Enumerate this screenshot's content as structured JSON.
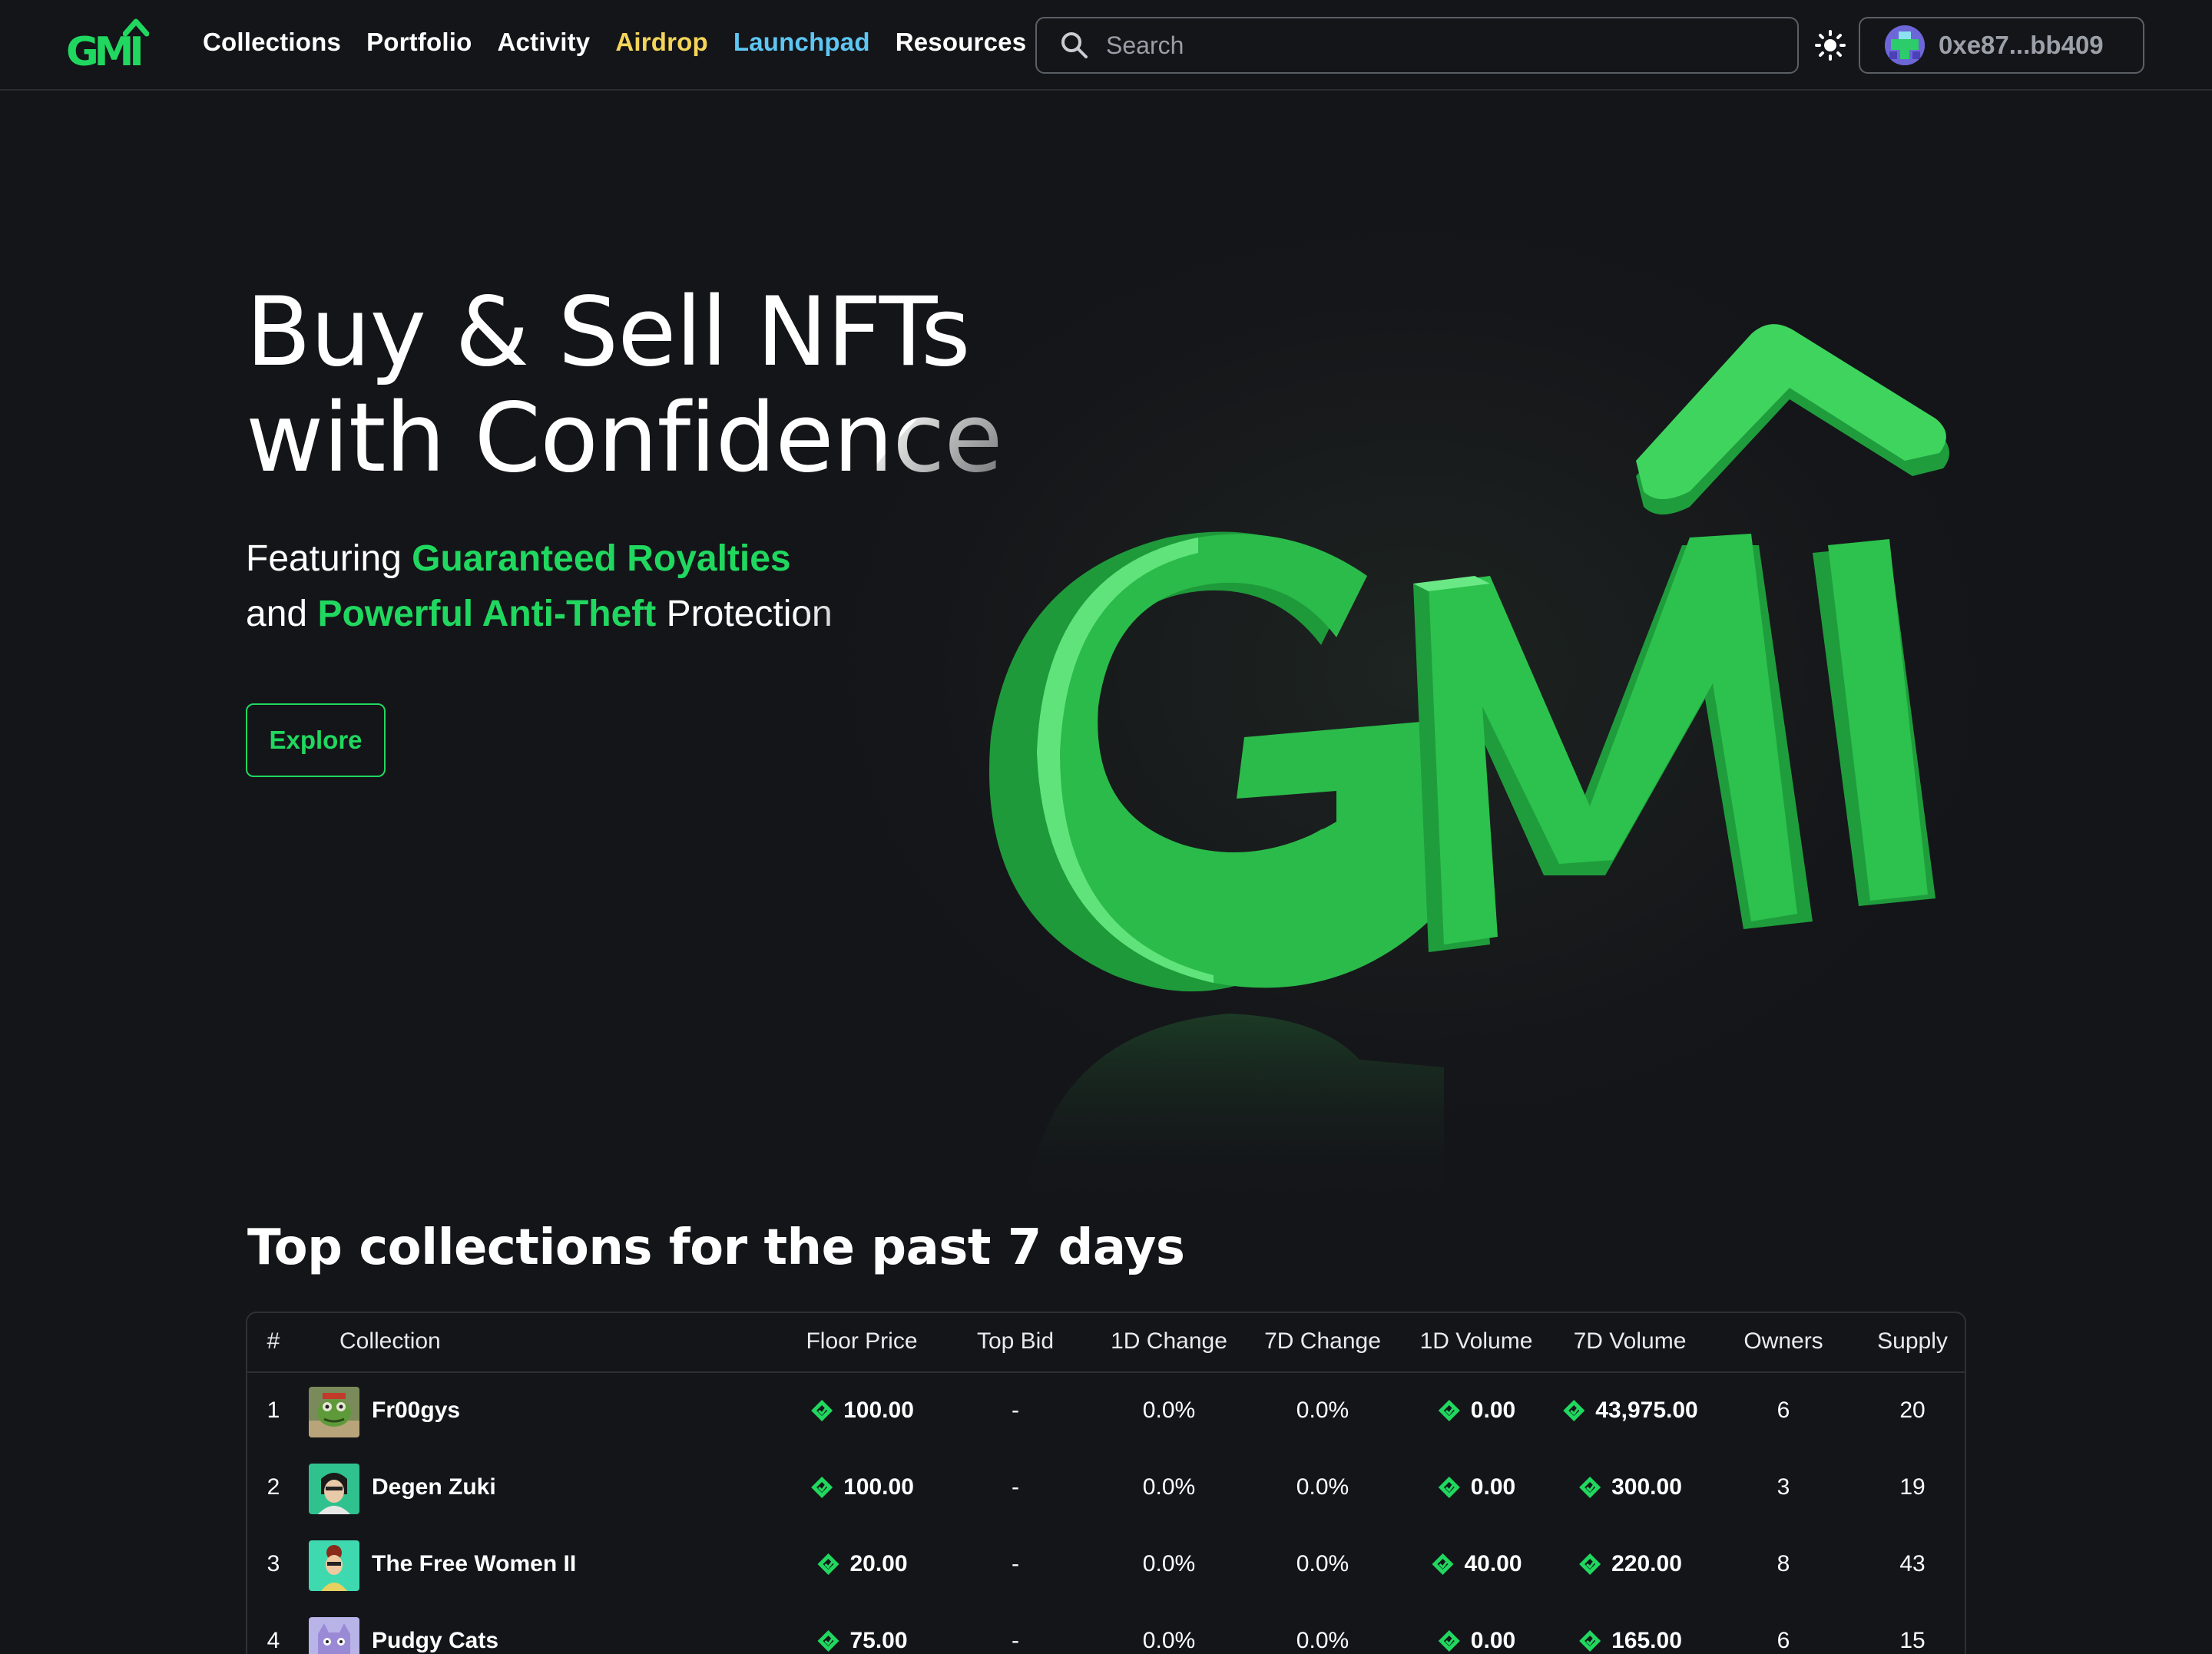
{
  "nav": {
    "logo_text": "GMI",
    "links": [
      "Collections",
      "Portfolio",
      "Activity",
      "Airdrop",
      "Launchpad",
      "Resources"
    ],
    "search_placeholder": "Search",
    "wallet_address": "0xe87...bb409"
  },
  "hero": {
    "title_line1": "Buy & Sell NFTs",
    "title_line2": "with Confidence",
    "sub_featuring": "Featuring",
    "sub_royalties": "Guaranteed Royalties",
    "sub_and": "and",
    "sub_antitheft": "Powerful Anti-Theft",
    "sub_protection": "Protection",
    "explore_label": "Explore"
  },
  "colors": {
    "background": "#141519",
    "accent_green": "#20d85f",
    "airdrop_yellow": "#f4d55a",
    "launchpad_blue": "#5ec6f2"
  },
  "table": {
    "title": "Top collections for the past 7 days",
    "headers": [
      "#",
      "Collection",
      "Floor Price",
      "Top Bid",
      "1D Change",
      "7D Change",
      "1D Volume",
      "7D Volume",
      "Owners",
      "Supply"
    ],
    "rows": [
      {
        "rank": "1",
        "name": "Fr00gys",
        "floor": "100.00",
        "top_bid": "-",
        "change_1d": "0.0%",
        "change_7d": "0.0%",
        "vol_1d": "0.00",
        "vol_7d": "43,975.00",
        "owners": "6",
        "supply": "20"
      },
      {
        "rank": "2",
        "name": "Degen Zuki",
        "floor": "100.00",
        "top_bid": "-",
        "change_1d": "0.0%",
        "change_7d": "0.0%",
        "vol_1d": "0.00",
        "vol_7d": "300.00",
        "owners": "3",
        "supply": "19"
      },
      {
        "rank": "3",
        "name": "The Free Women II",
        "floor": "20.00",
        "top_bid": "-",
        "change_1d": "0.0%",
        "change_7d": "0.0%",
        "vol_1d": "40.00",
        "vol_7d": "220.00",
        "owners": "8",
        "supply": "43"
      },
      {
        "rank": "4",
        "name": "Pudgy Cats",
        "floor": "75.00",
        "top_bid": "-",
        "change_1d": "0.0%",
        "change_7d": "0.0%",
        "vol_1d": "0.00",
        "vol_7d": "165.00",
        "owners": "6",
        "supply": "15"
      }
    ]
  }
}
